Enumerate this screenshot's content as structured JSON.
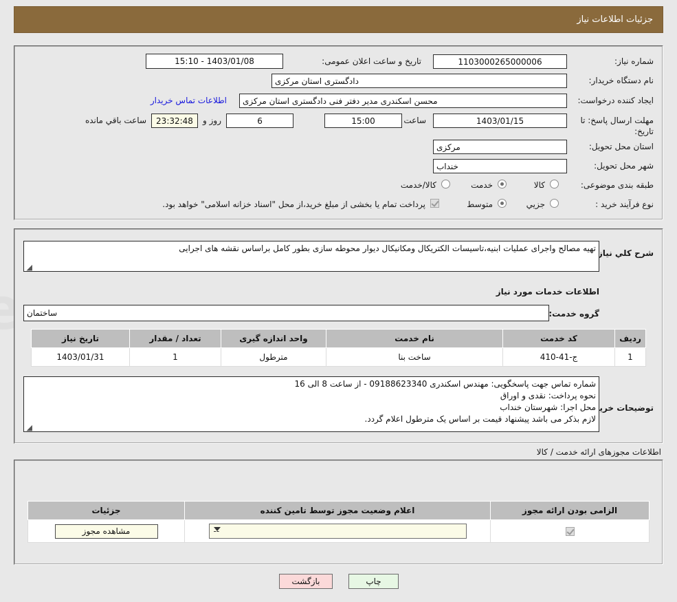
{
  "header": {
    "title": "جزئیات اطلاعات نیاز"
  },
  "need_info": {
    "need_number_label": "شماره نیاز:",
    "need_number_value": "1103000265000006",
    "announce_label": "تاریخ و ساعت اعلان عمومی:",
    "announce_value": "1403/01/08 - 15:10",
    "buyer_org_label": "نام دستگاه خریدار:",
    "buyer_org_value": "دادگستری استان مرکزی",
    "creator_label": "ایجاد کننده درخواست:",
    "creator_value": "محسن اسکندری مدیر دفتر فنی دادگستری استان مرکزی",
    "contact_link": "اطلاعات تماس خریدار",
    "deadline_label": "مهلت ارسال پاسخ: تا تاریخ:",
    "deadline_date": "1403/01/15",
    "deadline_time_label": "ساعت",
    "deadline_time": "15:00",
    "remaining_days": "6",
    "remaining_days_label": "روز و",
    "remaining_clock": "23:32:48",
    "remaining_suffix_label": "ساعت باقي مانده",
    "province_label": "استان محل تحویل:",
    "province_value": "مرکزی",
    "city_label": "شهر محل تحویل:",
    "city_value": "خنداب",
    "category_label": "طبقه بندی موضوعی:",
    "category_options": [
      "کالا",
      "خدمت",
      "کالا/خدمت"
    ],
    "category_selected": "خدمت",
    "process_label": "نوع فرآیند خرید :",
    "process_options": [
      "جزيي",
      "متوسط"
    ],
    "process_selected": "متوسط",
    "treasury_note": "پرداخت تمام یا بخشی از مبلغ خرید،از محل \"اسناد خزانه اسلامی\" خواهد بود.",
    "treasury_checked": true
  },
  "description": {
    "label": "شرح کلي نیاز:",
    "value": "تهیه مصالح واجرای عملیات ابنیه،تاسیسات الکتریکال ومکانیکال دیوار محوطه سازی بطور کامل براساس نقشه های اجرایی"
  },
  "services": {
    "section_title": "اطلاعات خدمات مورد نیاز",
    "group_label": "گروه خدمت:",
    "group_value": "ساختمان",
    "columns": [
      "ردیف",
      "کد خدمت",
      "نام خدمت",
      "واحد اندازه گیری",
      "تعداد / مقدار",
      "تاریخ نیاز"
    ],
    "rows": [
      {
        "row": "1",
        "code": "ج-41-410",
        "name": "ساخت بنا",
        "unit": "مترطول",
        "qty": "1",
        "date": "1403/01/31"
      }
    ]
  },
  "buyer_notes": {
    "label": "توضیحات خریدار:",
    "lines": [
      "شماره تماس جهت پاسخگویی: مهندس اسکندری 09188623340 - از ساعت 8 الی 16",
      "نحوه پرداخت: نقدی و اوراق",
      "محل اجرا: شهرستان خنداب",
      "لازم بذکر می باشد پیشنهاد قیمت بر اساس یک مترطول اعلام گردد."
    ]
  },
  "permits": {
    "section_title": "اطلاعات مجوزهای ارائه خدمت / کالا",
    "columns": [
      "الزامی بودن ارائه مجوز",
      "اعلام وضعیت مجوز توسط تامین کننده",
      "جزئیات"
    ],
    "rows": [
      {
        "required": true,
        "status_value": "--",
        "details_button": "مشاهده مجوز"
      }
    ]
  },
  "footer": {
    "print_label": "چاپ",
    "back_label": "بازگشت"
  },
  "colors": {
    "header_bg": "#8a6a3c",
    "page_bg": "#e8e8e8",
    "link": "#1818dd",
    "table_header": "#bebebe",
    "print_btn": "#e7f7e4",
    "back_btn": "#fbd9d9",
    "field_yellow": "#fbfbe7"
  }
}
